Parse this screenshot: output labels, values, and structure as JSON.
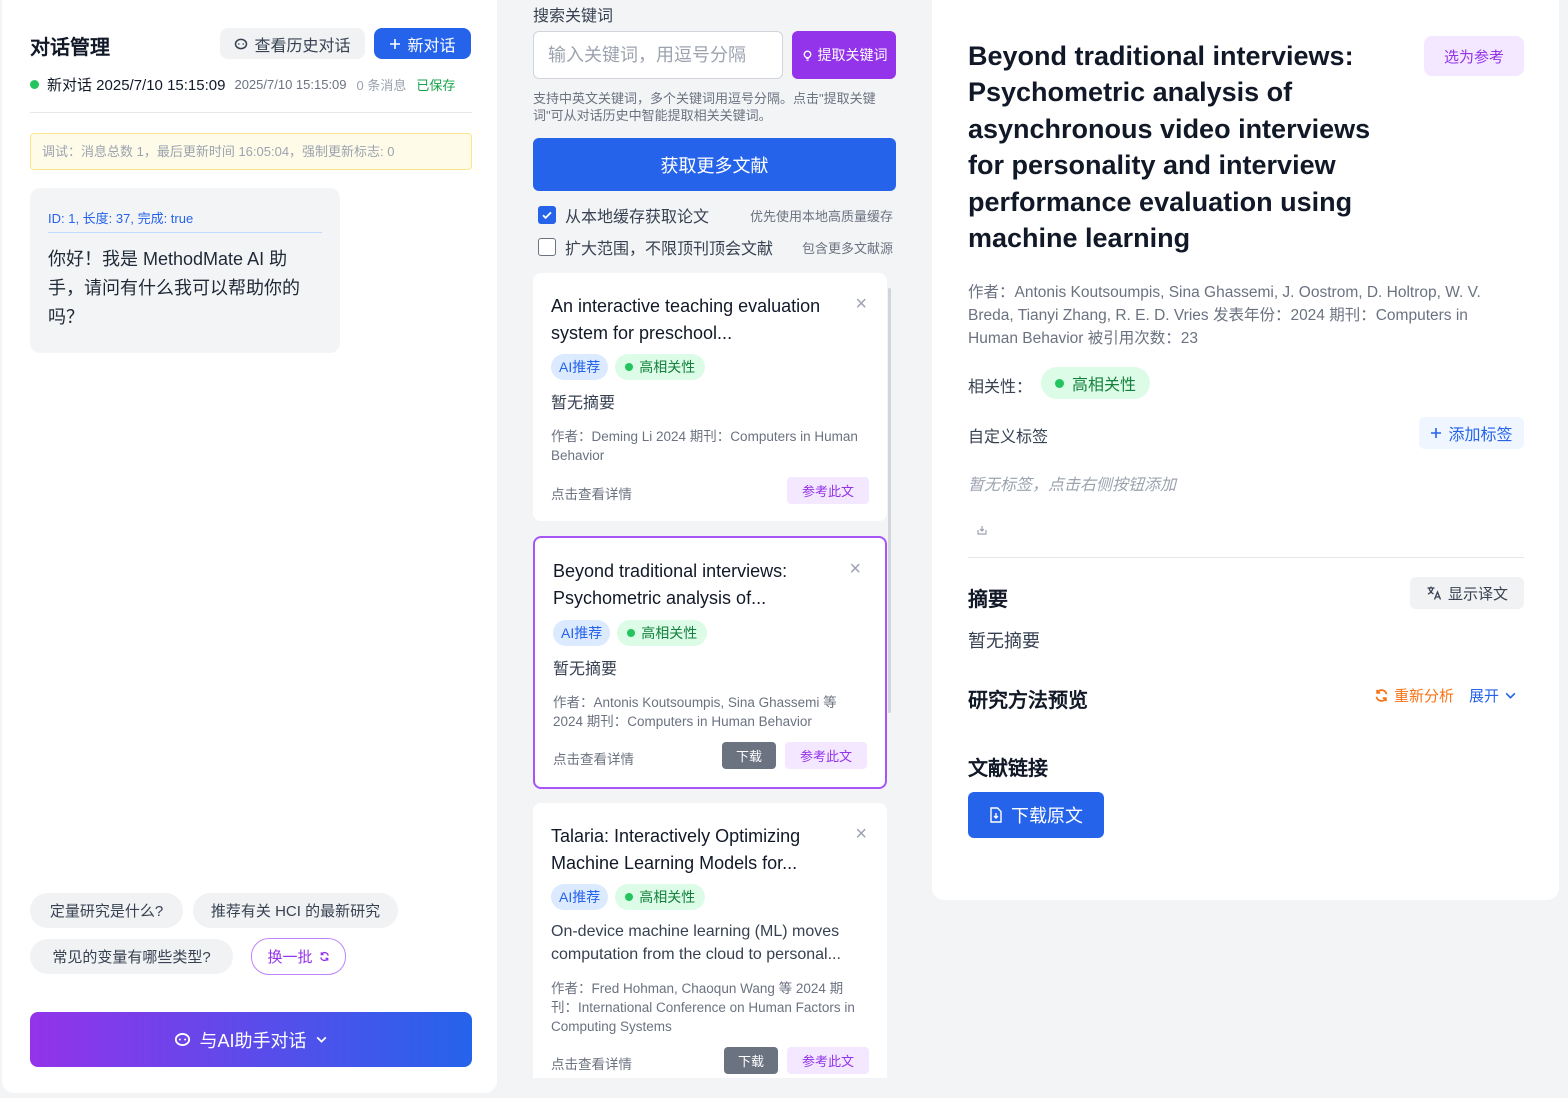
{
  "left": {
    "title": "对话管理",
    "history_button": "查看历史对话",
    "new_chat_button": "新对话",
    "session": {
      "name": "新对话 2025/7/10 15:15:09",
      "time": "2025/7/10 15:15:09",
      "count": "0 条消息",
      "status": "已保存"
    },
    "debug": "调试：消息总数 1，最后更新时间 16:05:04，强制更新标志: 0",
    "message": {
      "meta": "ID: 1, 长度: 37, 完成: true",
      "text": "你好！我是 MethodMate AI 助手，请问有什么我可以帮助你的吗？"
    },
    "suggestions": [
      "定量研究是什么?",
      "推荐有关 HCI 的最新研究",
      "常见的变量有哪些类型?"
    ],
    "refresh_label": "换一批",
    "chat_button": "与AI助手对话"
  },
  "search": {
    "label": "搜索关键词",
    "placeholder": "输入关键词，用逗号分隔",
    "value": "",
    "extract_button": "提取关键词",
    "help": "支持中英文关键词，多个关键词用逗号分隔。点击\"提取关键词\"可从对话历史中智能提取相关关键词。",
    "more_button": "获取更多文献",
    "options": [
      {
        "label": "从本地缓存获取论文",
        "hint": "优先使用本地高质量缓存",
        "checked": true
      },
      {
        "label": "扩大范围，不限顶刊顶会文献",
        "hint": "包含更多文献源",
        "checked": false
      }
    ]
  },
  "papers": [
    {
      "title": "An interactive teaching evaluation system for preschool...",
      "ai_badge": "AI推荐",
      "relevance": "高相关性",
      "abstract": "暂无摘要",
      "meta": "作者：Deming Li   2024   期刊：Computers in Human Behavior",
      "detail_link": "点击查看详情",
      "download": "",
      "reference": "参考此文"
    },
    {
      "title": "Beyond traditional interviews: Psychometric analysis of...",
      "ai_badge": "AI推荐",
      "relevance": "高相关性",
      "abstract": "暂无摘要",
      "meta": "作者：Antonis Koutsoumpis, Sina Ghassemi 等   2024   期刊：Computers in Human Behavior",
      "detail_link": "点击查看详情",
      "download": "下载",
      "reference": "参考此文"
    },
    {
      "title": "Talaria: Interactively Optimizing Machine Learning Models for...",
      "ai_badge": "AI推荐",
      "relevance": "高相关性",
      "abstract": "On-device machine learning (ML) moves computation from the cloud to personal...",
      "meta": "作者：Fred Hohman, Chaoqun Wang 等   2024   期刊：International Conference on Human Factors in Computing Systems",
      "detail_link": "点击查看详情",
      "download": "下载",
      "reference": "参考此文"
    }
  ],
  "detail": {
    "title": "Beyond traditional interviews: Psychometric analysis of asynchronous video interviews for personality and interview performance evaluation using machine learning",
    "set_ref_button": "选为参考",
    "meta": "作者：Antonis Koutsoumpis, Sina Ghassemi, J. Oostrom, D. Holtrop, W. V. Breda, Tianyi Zhang, R. E. D. Vries     发表年份：2024     期刊：Computers in Human Behavior     被引用次数：23",
    "relevance_label": "相关性：",
    "relevance": "高相关性",
    "tag_label": "自定义标签",
    "add_tag_button": "添加标签",
    "tag_empty": "暂无标签，点击右侧按钮添加",
    "abstract_heading": "摘要",
    "translate_button": "显示译文",
    "abstract": "暂无摘要",
    "method_heading": "研究方法预览",
    "reanalyze": "重新分析",
    "expand": "展开",
    "link_heading": "文献链接",
    "download_button": "下载原文"
  },
  "colors": {
    "primary": "#2563eb",
    "purple": "#9333ea",
    "success": "#22c55e",
    "warning": "#f97316"
  }
}
